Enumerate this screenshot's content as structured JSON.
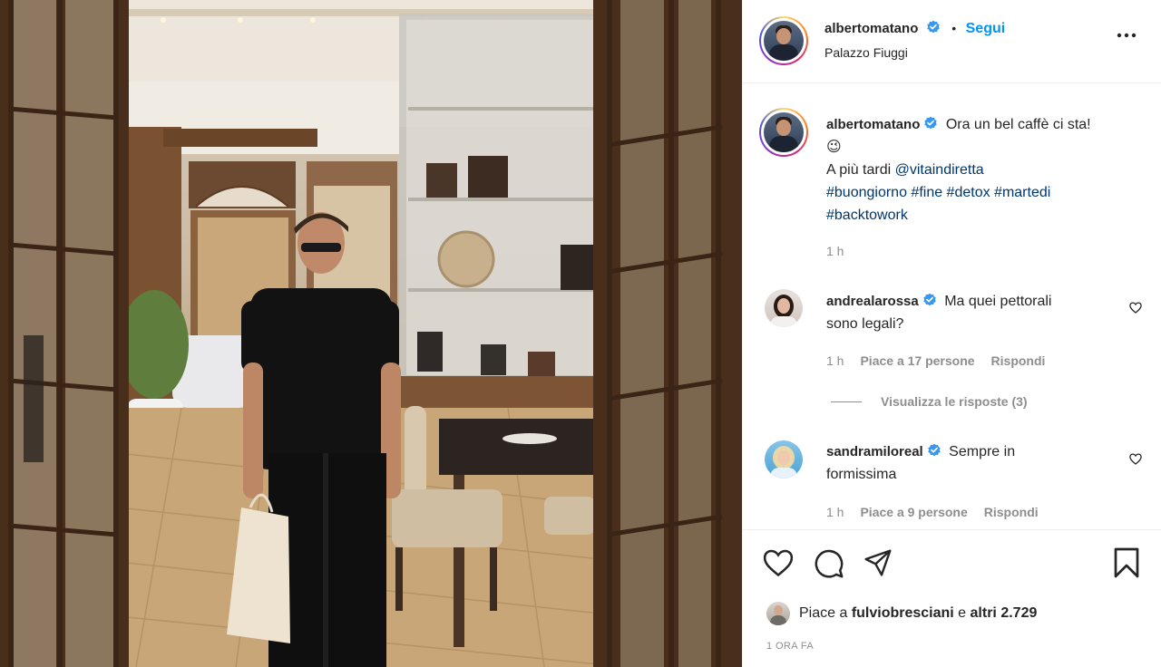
{
  "post": {
    "username": "albertomatano",
    "follow_label": "Segui",
    "dot": "•",
    "location": "Palazzo Fiuggi"
  },
  "caption": {
    "username": "albertomatano",
    "text": "Ora un bel caffè ci sta!",
    "emoji": "😉",
    "line2_prefix": "A più tardi ",
    "mention": "@vitaindiretta",
    "hashtags_line1": "#buongiorno #fine #detox #martedi",
    "hashtags_line2": "#backtowork",
    "time": "1 h"
  },
  "comments": [
    {
      "username": "andrealarossa",
      "text_line1": "Ma quei pettorali",
      "text_line2": "sono legali?",
      "time": "1 h",
      "likes": "Piace a 17 persone",
      "reply": "Rispondi",
      "view_replies": "Visualizza le risposte (3)"
    },
    {
      "username": "sandramiloreal",
      "text_line1": "Sempre in",
      "text_line2": "formissima",
      "time": "1 h",
      "likes": "Piace a 9 persone",
      "reply": "Rispondi"
    }
  ],
  "likes_bar": {
    "prefix": "Piace a ",
    "user": "fulviobresciani",
    "middle": " e ",
    "others": "altri 2.729"
  },
  "posted": "1 ORA FA",
  "colors": {
    "accent": "#0095f6",
    "verified": "#3897f0",
    "secondary_text": "#8e8e8e",
    "link": "#00376b"
  },
  "icons": [
    "verified-badge-icon",
    "more-options-icon",
    "heart-icon",
    "comment-icon",
    "share-icon",
    "bookmark-icon"
  ]
}
